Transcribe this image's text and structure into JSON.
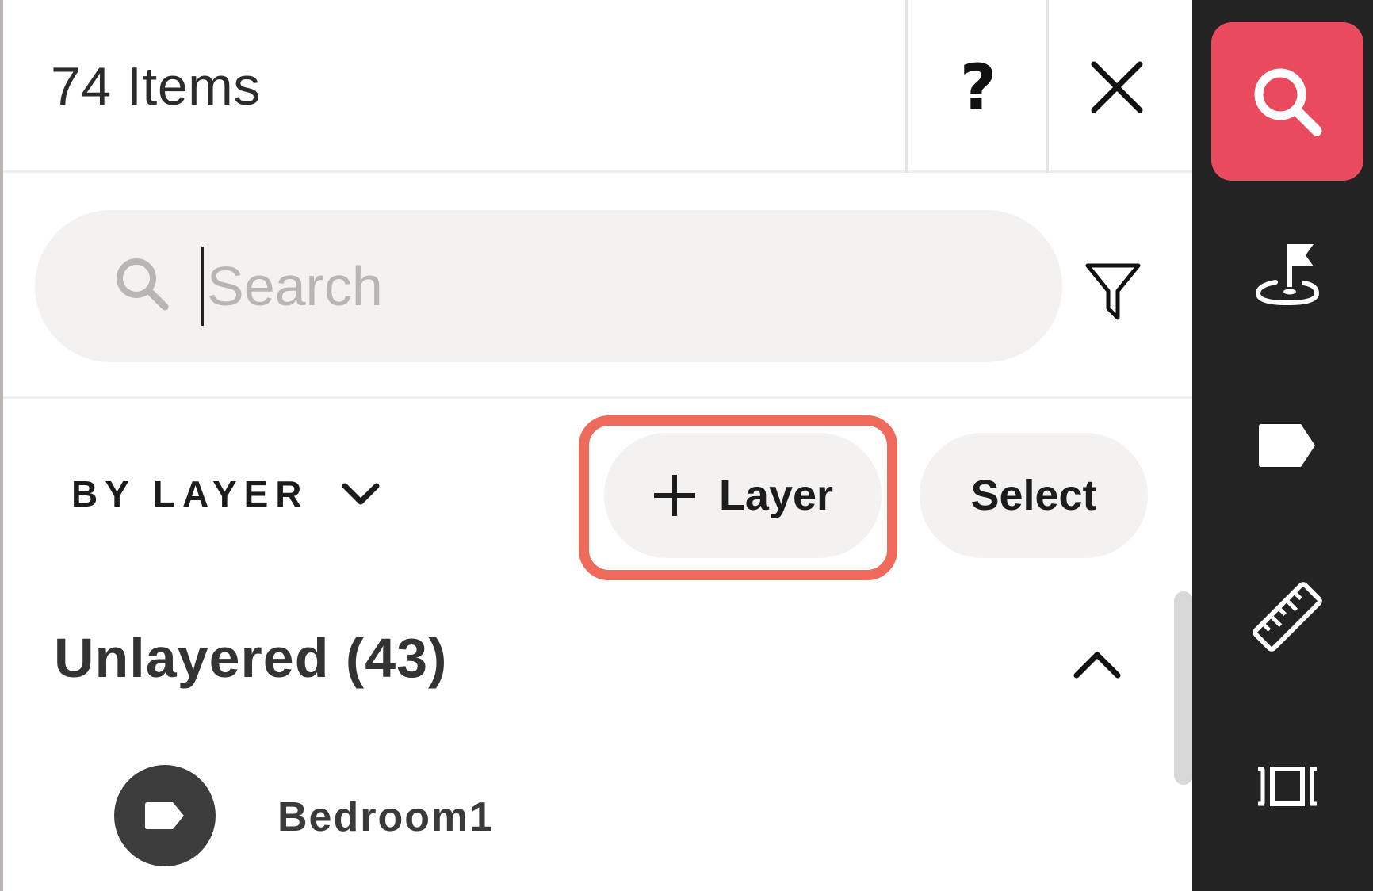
{
  "header": {
    "items_count": "74 Items",
    "help_label": "?"
  },
  "search": {
    "placeholder": "Search",
    "value": ""
  },
  "toolbar": {
    "group_by_label": "BY LAYER",
    "add_layer_label": "Layer",
    "select_label": "Select"
  },
  "groups": [
    {
      "title": "Unlayered (43)",
      "items": [
        {
          "name": "Bedroom1",
          "icon": "tag-icon"
        }
      ]
    }
  ],
  "rail": {
    "buttons": [
      {
        "icon": "search-icon",
        "active": true
      },
      {
        "icon": "location-flag-icon",
        "active": false
      },
      {
        "icon": "tag-icon",
        "active": false
      },
      {
        "icon": "ruler-icon",
        "active": false
      },
      {
        "icon": "dimension-icon",
        "active": false
      }
    ]
  },
  "colors": {
    "accent": "#ea4a5e",
    "highlight_outline": "#ee6b5b",
    "rail_background": "#232323",
    "pill_background": "#f3f2f1"
  }
}
